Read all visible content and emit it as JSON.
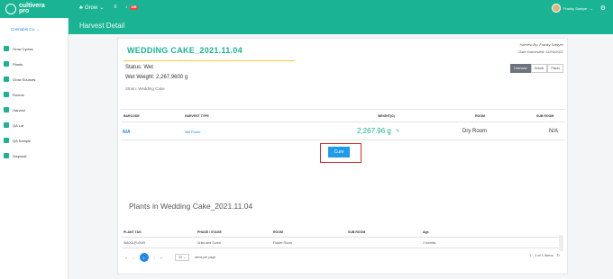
{
  "brand": {
    "line1": "cultivera",
    "line2": "pro"
  },
  "topbar": {
    "grow_label": "Grow",
    "alert_count": "158",
    "user_name": "Franky Sawyer"
  },
  "sidebar": {
    "company": "Cannabis Co. ⌄",
    "items": [
      {
        "label": "Grow Cycles"
      },
      {
        "label": "Plants"
      },
      {
        "label": "Grow Sources"
      },
      {
        "label": "Rooms"
      },
      {
        "label": "Harvest"
      },
      {
        "label": "QA Lot"
      },
      {
        "label": "QA Sample"
      },
      {
        "label": "Disposal"
      }
    ]
  },
  "page": {
    "title": "Harvest Detail"
  },
  "harvest": {
    "name": "WEDDING CAKE_2021.11.04",
    "status": "Status: Wet",
    "wet_weight": "Wet Weight: 2,267.9600 g",
    "strain": "Strain: Wedding Cake",
    "harvested_by": "Harvest By: Franky Sawyer",
    "date_harvested": "Date Harvested: 11/04/2021",
    "tabs": [
      "Overview",
      "Details",
      "Plants"
    ]
  },
  "harvest_table": {
    "headers": [
      "BARCODE",
      "HARVEST TYPE",
      "WEIGHT(G)",
      "ROOM",
      "SUB ROOM"
    ],
    "row": {
      "barcode": "N/A",
      "type": "Wet Flower",
      "weight": "2,267.96  g",
      "room": "Dry Room",
      "sub_room": "N/A"
    }
  },
  "cure_button": "Cure",
  "plants": {
    "title": "Plants in Wedding Cake_2021.11.04",
    "headers": [
      "PLANT TAG",
      "PHASE / STAGE",
      "ROOM",
      "SUB ROOM",
      "Age"
    ],
    "row": {
      "tag": "WA0GLPL0049",
      "phase": "Dried and Cured",
      "room": "Flower Room",
      "sub_room": "",
      "age": "3 months"
    }
  },
  "pagination": {
    "current_page": "1",
    "page_size": "20",
    "items_per_page": "items per page",
    "range": "1 - 1 of 1 items"
  },
  "colors": {
    "brand_green": "#1ab394",
    "link_blue": "#1e88e5",
    "highlight_red": "#d32f2f",
    "title_underline": "#f7c843"
  }
}
